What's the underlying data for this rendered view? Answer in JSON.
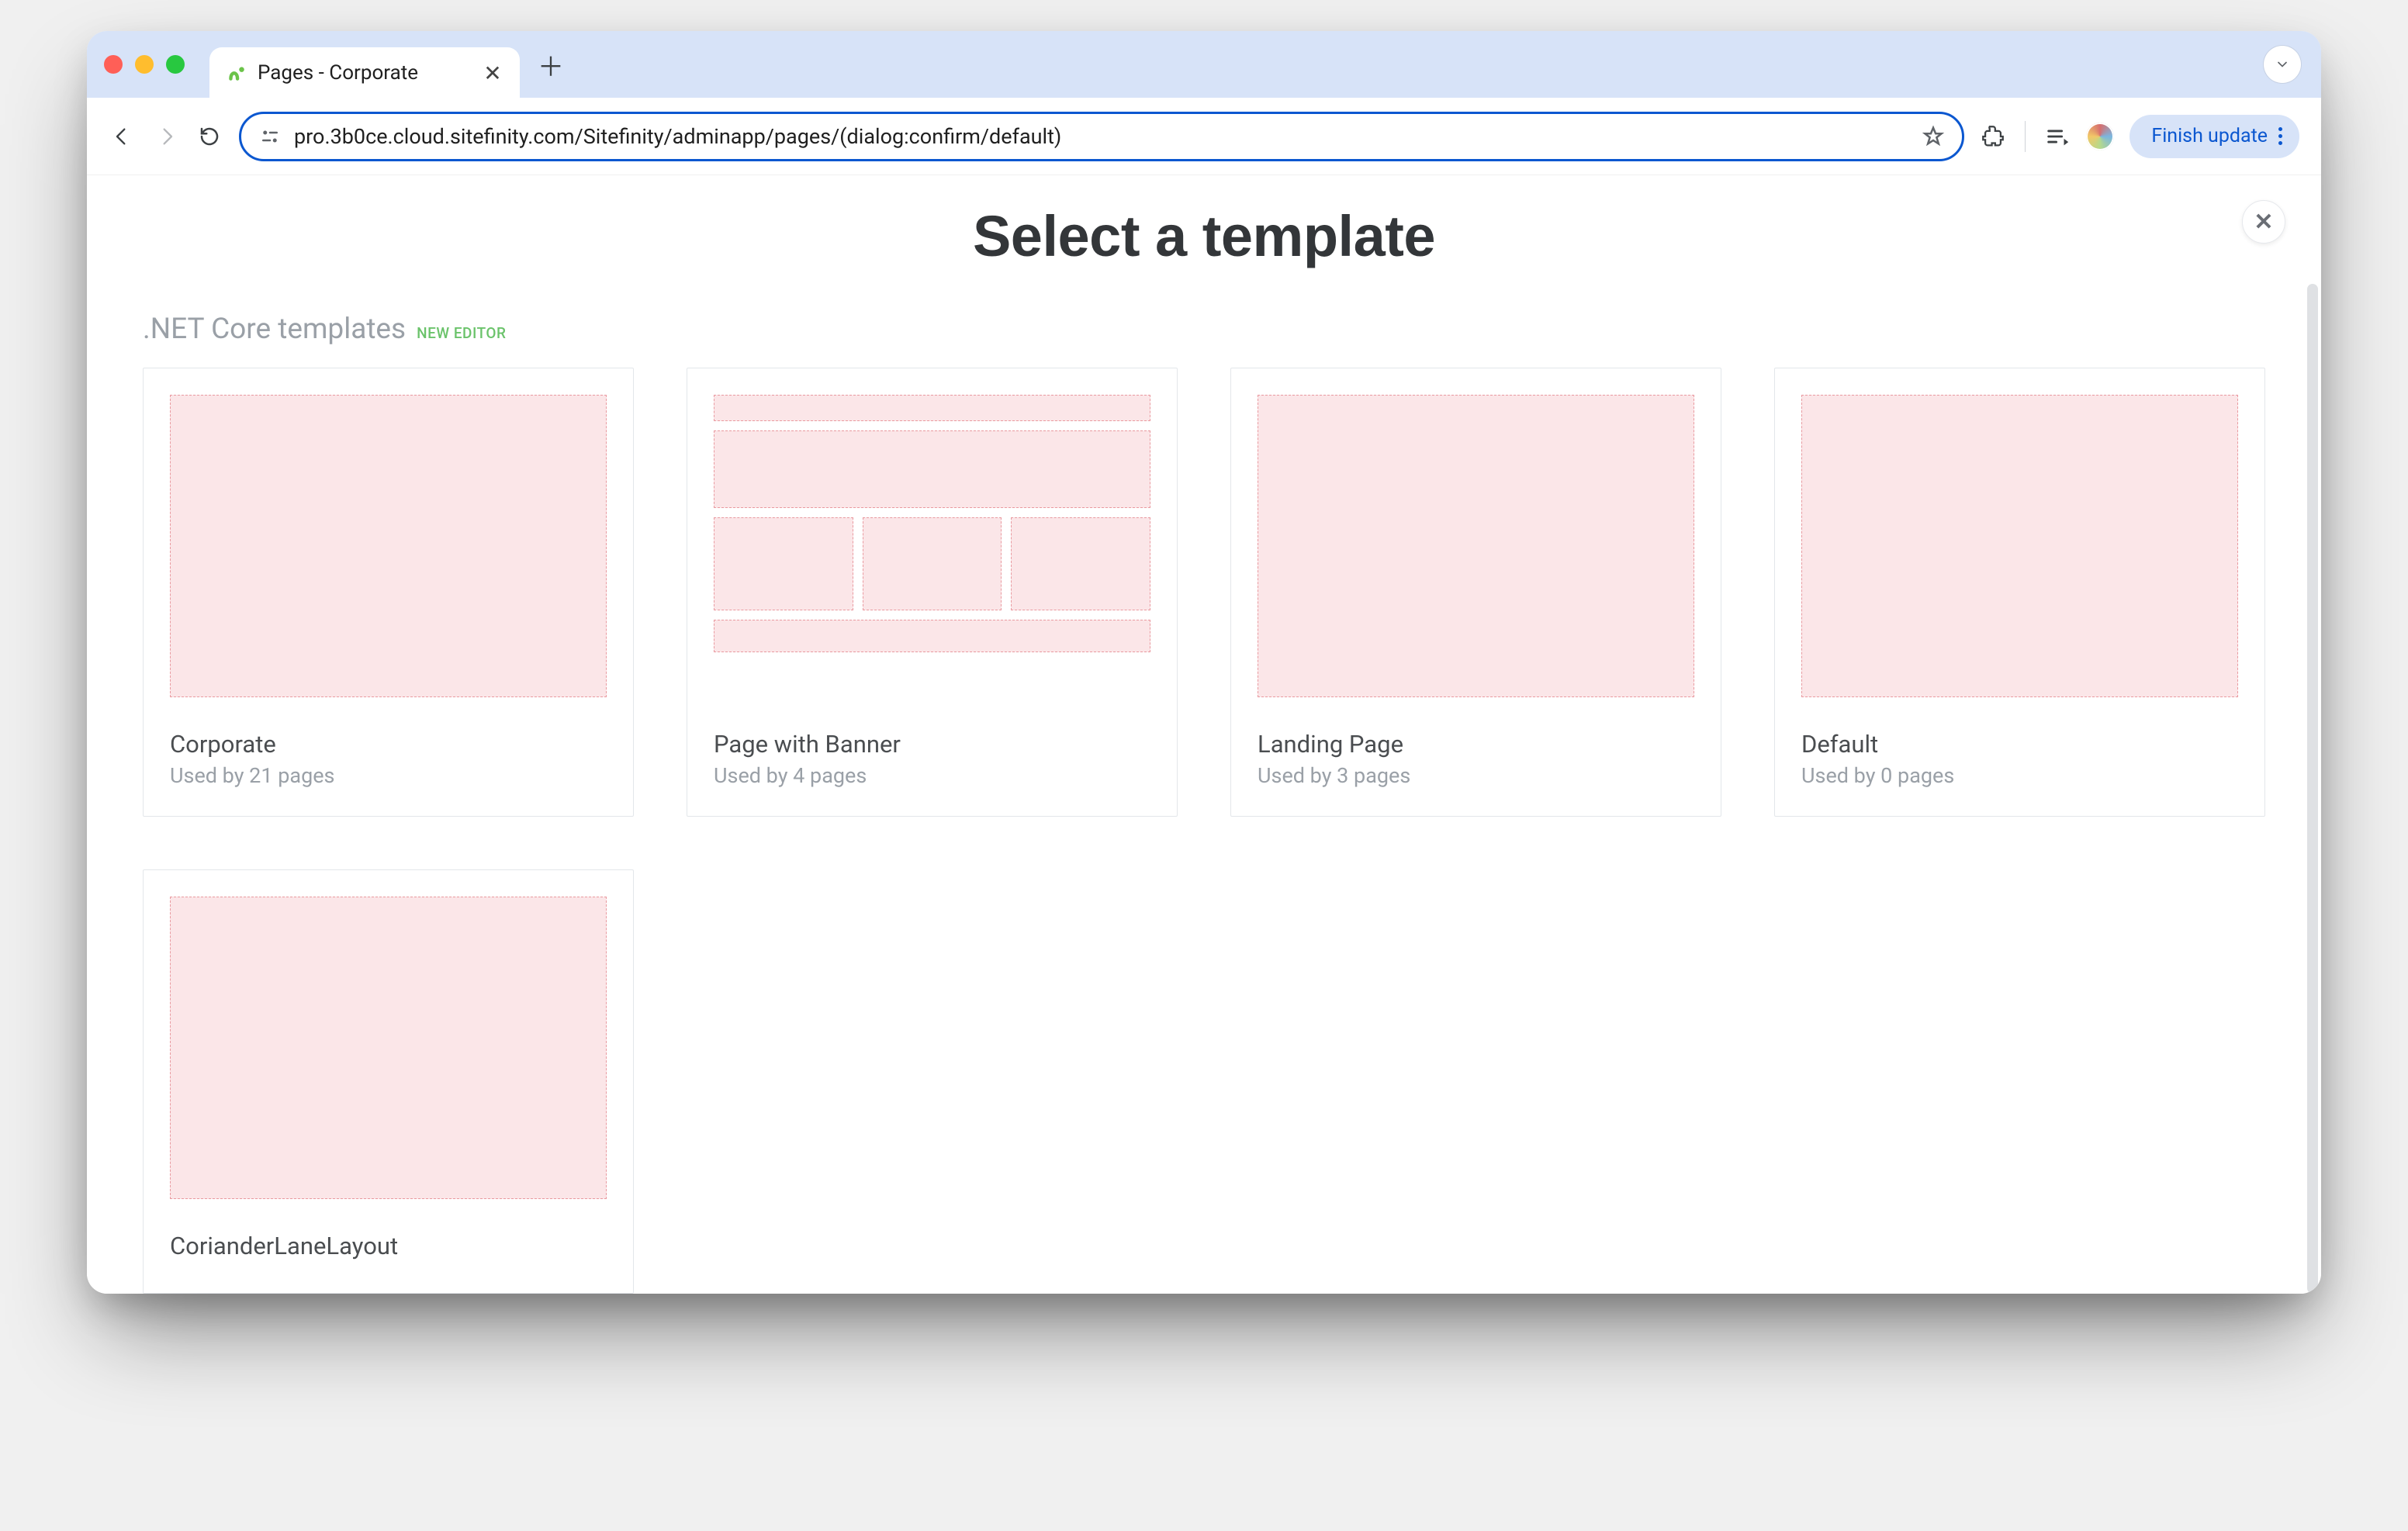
{
  "browser": {
    "tab_title": "Pages - Corporate",
    "url": "pro.3b0ce.cloud.sitefinity.com/Sitefinity/adminapp/pages/(dialog:confirm/default)",
    "finish_update_label": "Finish update"
  },
  "dialog": {
    "title": "Select a template",
    "section_title": ".NET Core templates",
    "section_badge": "NEW EDITOR"
  },
  "templates": [
    {
      "name": "Corporate",
      "usage": "Used by 21 pages",
      "preview": "single"
    },
    {
      "name": "Page with Banner",
      "usage": "Used by 4 pages",
      "preview": "banner"
    },
    {
      "name": "Landing Page",
      "usage": "Used by 3 pages",
      "preview": "single"
    },
    {
      "name": "Default",
      "usage": "Used by 0 pages",
      "preview": "single"
    },
    {
      "name": "CorianderLaneLayout",
      "usage": "",
      "preview": "single"
    }
  ]
}
